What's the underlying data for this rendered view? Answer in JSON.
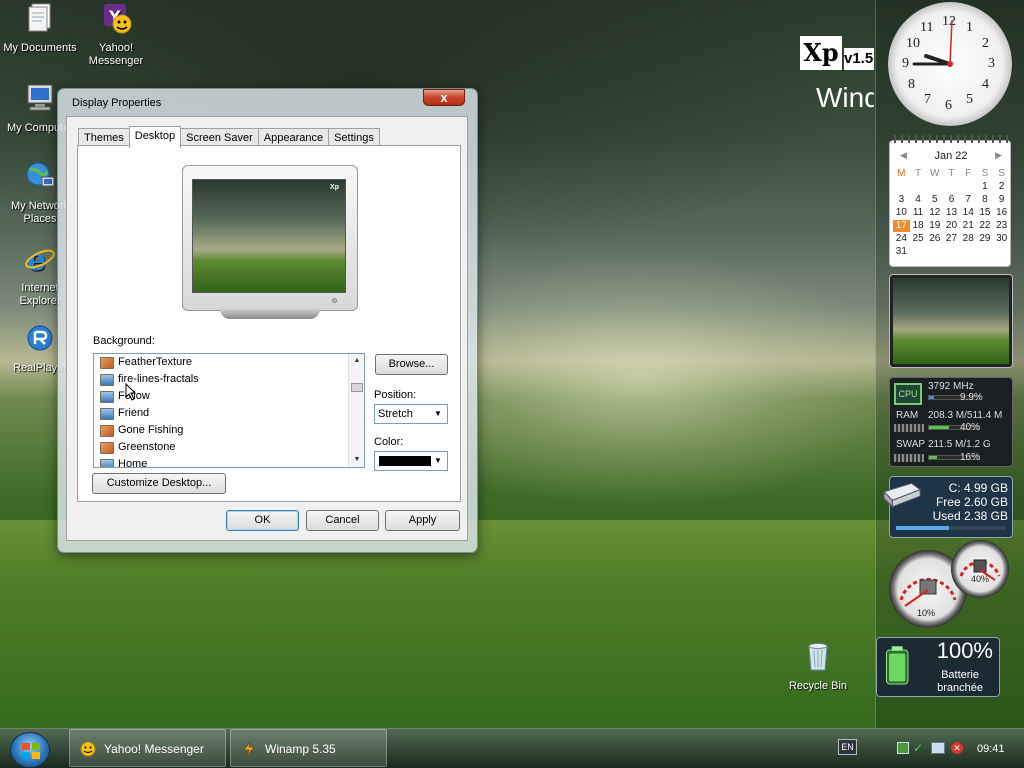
{
  "desktop": {
    "icons": [
      {
        "label": "My Documents",
        "icon": "documents-icon"
      },
      {
        "label": "Yahoo! Messenger",
        "icon": "yahoo-messenger-icon"
      },
      {
        "label": "My Computer",
        "icon": "computer-icon"
      },
      {
        "label": "My Network Places",
        "icon": "network-icon"
      },
      {
        "label": "Internet Explorer",
        "icon": "internet-explorer-icon"
      },
      {
        "label": "RealPlayer",
        "icon": "realplayer-icon"
      },
      {
        "label": "Recycle Bin",
        "icon": "recycle-bin-icon"
      }
    ],
    "wallpaper_logo": "Xp",
    "wallpaper_version": "v1.5",
    "wallpaper_brand": "Windo"
  },
  "dialog": {
    "title": "Display Properties",
    "close_label": "x",
    "tabs": [
      {
        "label": "Themes"
      },
      {
        "label": "Desktop",
        "active": true
      },
      {
        "label": "Screen Saver"
      },
      {
        "label": "Appearance"
      },
      {
        "label": "Settings"
      }
    ],
    "background_label": "Background:",
    "background_items": [
      {
        "label": "FeatherTexture",
        "icon": "image-icon"
      },
      {
        "label": "fire-lines-fractals",
        "icon": "wallpaper-icon"
      },
      {
        "label": "Follow",
        "icon": "wallpaper-icon"
      },
      {
        "label": "Friend",
        "icon": "wallpaper-icon"
      },
      {
        "label": "Gone Fishing",
        "icon": "image-icon"
      },
      {
        "label": "Greenstone",
        "icon": "image-icon"
      },
      {
        "label": "Home",
        "icon": "wallpaper-icon"
      }
    ],
    "browse_label": "Browse...",
    "position_label": "Position:",
    "position_value": "Stretch",
    "color_label": "Color:",
    "color_value": "#000000",
    "customize_label": "Customize Desktop...",
    "ok_label": "OK",
    "cancel_label": "Cancel",
    "apply_label": "Apply"
  },
  "sidebar": {
    "clock_numbers": [
      "12",
      "1",
      "2",
      "3",
      "4",
      "5",
      "6",
      "7",
      "8",
      "9",
      "10",
      "11"
    ],
    "calendar": {
      "month": "Jan 22",
      "weekdays": [
        "M",
        "T",
        "W",
        "T",
        "F",
        "S",
        "S"
      ],
      "weeks": [
        [
          "",
          "",
          "",
          "",
          "",
          "1",
          "2"
        ],
        [
          "3",
          "4",
          "5",
          "6",
          "7",
          "8",
          "9"
        ],
        [
          "10",
          "11",
          "12",
          "13",
          "14",
          "15",
          "16"
        ],
        [
          "17",
          "18",
          "19",
          "20",
          "21",
          "22",
          "23"
        ],
        [
          "24",
          "25",
          "26",
          "27",
          "28",
          "29",
          "30"
        ],
        [
          "31",
          "",
          "",
          "",
          "",
          "",
          ""
        ]
      ],
      "today": "17"
    },
    "cpu": {
      "label": "CPU",
      "freq": "3792 MHz",
      "usage": "9.9%",
      "usage_value": 0.099
    },
    "ram": {
      "label": "RAM",
      "value": "208.3 M/511.4 M",
      "percent": "40%",
      "fill": 0.4
    },
    "swap": {
      "label": "SWAP",
      "value": "211.5 M/1.2 G",
      "percent": "16%",
      "fill": 0.16
    },
    "drive": {
      "name": "C:  4.99 GB",
      "free": "Free 2.60 GB",
      "used": "Used 2.38 GB",
      "fill": 0.48
    },
    "gauges": {
      "cpu_percent": "10%",
      "mem_percent": "40%"
    },
    "battery": {
      "percent": "100%",
      "line1": "Batterie",
      "line2": "branchée"
    }
  },
  "taskbar": {
    "items": [
      {
        "label": "Yahoo! Messenger",
        "icon": "yahoo-smiley-icon"
      },
      {
        "label": "Winamp 5.35",
        "icon": "winamp-icon"
      }
    ],
    "language": "EN",
    "time": "09:41"
  }
}
